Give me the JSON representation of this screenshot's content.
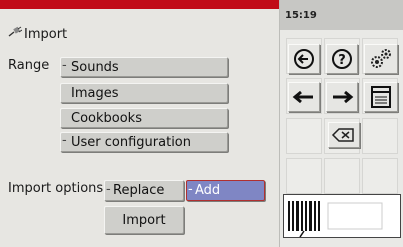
{
  "header": {
    "title": "Import"
  },
  "status": {
    "time": "15:19"
  },
  "range": {
    "label": "Range",
    "options": [
      "Sounds",
      "Images",
      "Cookbooks",
      "User configuration"
    ]
  },
  "import_options": {
    "label": "Import options",
    "replace_label": "Replace",
    "add_label": "Add",
    "selected": "Add"
  },
  "actions": {
    "import_label": "Import"
  },
  "colors": {
    "red_bar": "#c10b18",
    "selected_bg": "#7f86c4",
    "selected_border": "#b03030"
  },
  "toolbar": {
    "icons": [
      "back-circle-icon",
      "help-icon",
      "settings-gears-icon",
      "arrow-left-icon",
      "arrow-right-icon",
      "window-icon",
      "backspace-icon"
    ]
  }
}
